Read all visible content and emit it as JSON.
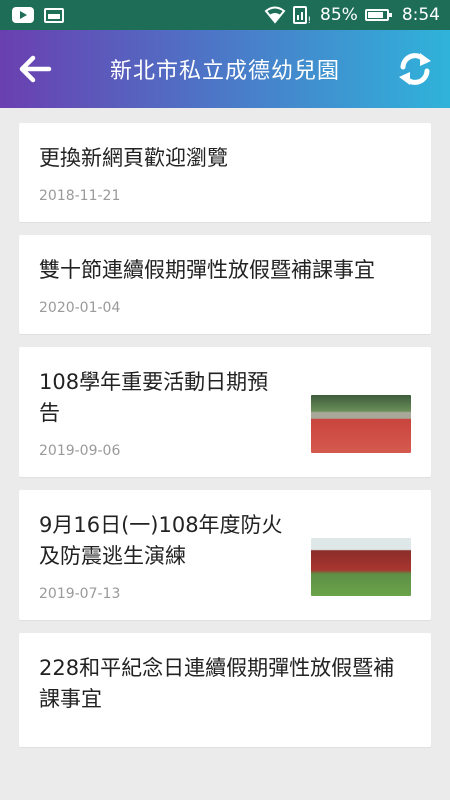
{
  "status_bar": {
    "battery_percent": "85%",
    "time": "8:54",
    "icons": [
      "youtube-icon",
      "gallery-icon",
      "wifi-icon",
      "signal-icon",
      "battery-icon"
    ]
  },
  "app_bar": {
    "title": "新北市私立成德幼兒園",
    "back_icon": "arrow-left-icon",
    "refresh_icon": "refresh-icon",
    "gradient": [
      "#6a3fb0",
      "#2fb3da"
    ]
  },
  "news": [
    {
      "title": "更換新網頁歡迎瀏覽",
      "date": "2018-11-21",
      "has_thumb": false
    },
    {
      "title": "雙十節連續假期彈性放假暨補課事宜",
      "date": "2020-01-04",
      "has_thumb": false
    },
    {
      "title": "108學年重要活動日期預告",
      "date": "2019-09-06",
      "has_thumb": true
    },
    {
      "title": "9月16日(一)108年度防火及防震逃生演練",
      "date": "2019-07-13",
      "has_thumb": true
    },
    {
      "title": "228和平紀念日連續假期彈性放假暨補課事宜",
      "date": "",
      "has_thumb": false
    }
  ]
}
